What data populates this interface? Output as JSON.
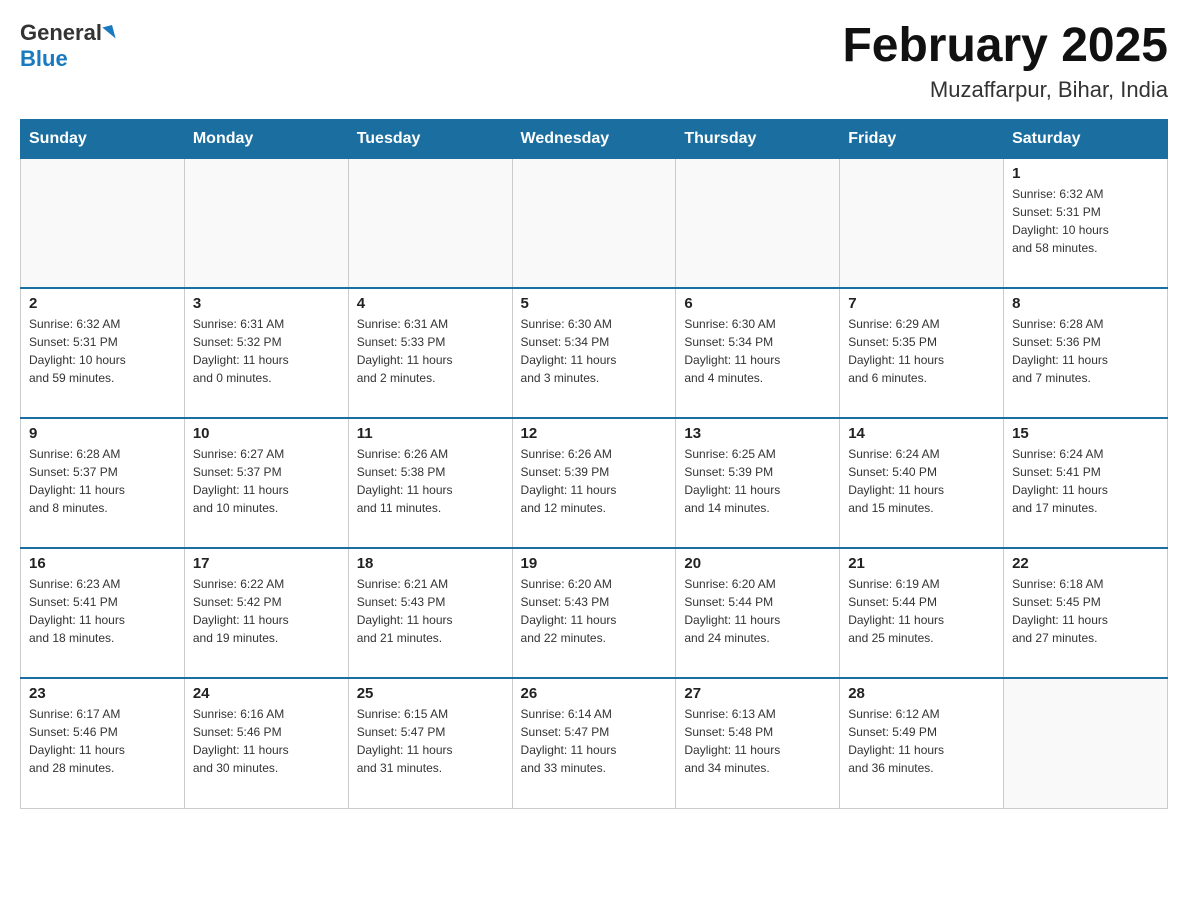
{
  "logo": {
    "general": "General",
    "blue": "Blue"
  },
  "title": "February 2025",
  "subtitle": "Muzaffarpur, Bihar, India",
  "headers": [
    "Sunday",
    "Monday",
    "Tuesday",
    "Wednesday",
    "Thursday",
    "Friday",
    "Saturday"
  ],
  "weeks": [
    [
      {
        "day": "",
        "info": ""
      },
      {
        "day": "",
        "info": ""
      },
      {
        "day": "",
        "info": ""
      },
      {
        "day": "",
        "info": ""
      },
      {
        "day": "",
        "info": ""
      },
      {
        "day": "",
        "info": ""
      },
      {
        "day": "1",
        "info": "Sunrise: 6:32 AM\nSunset: 5:31 PM\nDaylight: 10 hours\nand 58 minutes."
      }
    ],
    [
      {
        "day": "2",
        "info": "Sunrise: 6:32 AM\nSunset: 5:31 PM\nDaylight: 10 hours\nand 59 minutes."
      },
      {
        "day": "3",
        "info": "Sunrise: 6:31 AM\nSunset: 5:32 PM\nDaylight: 11 hours\nand 0 minutes."
      },
      {
        "day": "4",
        "info": "Sunrise: 6:31 AM\nSunset: 5:33 PM\nDaylight: 11 hours\nand 2 minutes."
      },
      {
        "day": "5",
        "info": "Sunrise: 6:30 AM\nSunset: 5:34 PM\nDaylight: 11 hours\nand 3 minutes."
      },
      {
        "day": "6",
        "info": "Sunrise: 6:30 AM\nSunset: 5:34 PM\nDaylight: 11 hours\nand 4 minutes."
      },
      {
        "day": "7",
        "info": "Sunrise: 6:29 AM\nSunset: 5:35 PM\nDaylight: 11 hours\nand 6 minutes."
      },
      {
        "day": "8",
        "info": "Sunrise: 6:28 AM\nSunset: 5:36 PM\nDaylight: 11 hours\nand 7 minutes."
      }
    ],
    [
      {
        "day": "9",
        "info": "Sunrise: 6:28 AM\nSunset: 5:37 PM\nDaylight: 11 hours\nand 8 minutes."
      },
      {
        "day": "10",
        "info": "Sunrise: 6:27 AM\nSunset: 5:37 PM\nDaylight: 11 hours\nand 10 minutes."
      },
      {
        "day": "11",
        "info": "Sunrise: 6:26 AM\nSunset: 5:38 PM\nDaylight: 11 hours\nand 11 minutes."
      },
      {
        "day": "12",
        "info": "Sunrise: 6:26 AM\nSunset: 5:39 PM\nDaylight: 11 hours\nand 12 minutes."
      },
      {
        "day": "13",
        "info": "Sunrise: 6:25 AM\nSunset: 5:39 PM\nDaylight: 11 hours\nand 14 minutes."
      },
      {
        "day": "14",
        "info": "Sunrise: 6:24 AM\nSunset: 5:40 PM\nDaylight: 11 hours\nand 15 minutes."
      },
      {
        "day": "15",
        "info": "Sunrise: 6:24 AM\nSunset: 5:41 PM\nDaylight: 11 hours\nand 17 minutes."
      }
    ],
    [
      {
        "day": "16",
        "info": "Sunrise: 6:23 AM\nSunset: 5:41 PM\nDaylight: 11 hours\nand 18 minutes."
      },
      {
        "day": "17",
        "info": "Sunrise: 6:22 AM\nSunset: 5:42 PM\nDaylight: 11 hours\nand 19 minutes."
      },
      {
        "day": "18",
        "info": "Sunrise: 6:21 AM\nSunset: 5:43 PM\nDaylight: 11 hours\nand 21 minutes."
      },
      {
        "day": "19",
        "info": "Sunrise: 6:20 AM\nSunset: 5:43 PM\nDaylight: 11 hours\nand 22 minutes."
      },
      {
        "day": "20",
        "info": "Sunrise: 6:20 AM\nSunset: 5:44 PM\nDaylight: 11 hours\nand 24 minutes."
      },
      {
        "day": "21",
        "info": "Sunrise: 6:19 AM\nSunset: 5:44 PM\nDaylight: 11 hours\nand 25 minutes."
      },
      {
        "day": "22",
        "info": "Sunrise: 6:18 AM\nSunset: 5:45 PM\nDaylight: 11 hours\nand 27 minutes."
      }
    ],
    [
      {
        "day": "23",
        "info": "Sunrise: 6:17 AM\nSunset: 5:46 PM\nDaylight: 11 hours\nand 28 minutes."
      },
      {
        "day": "24",
        "info": "Sunrise: 6:16 AM\nSunset: 5:46 PM\nDaylight: 11 hours\nand 30 minutes."
      },
      {
        "day": "25",
        "info": "Sunrise: 6:15 AM\nSunset: 5:47 PM\nDaylight: 11 hours\nand 31 minutes."
      },
      {
        "day": "26",
        "info": "Sunrise: 6:14 AM\nSunset: 5:47 PM\nDaylight: 11 hours\nand 33 minutes."
      },
      {
        "day": "27",
        "info": "Sunrise: 6:13 AM\nSunset: 5:48 PM\nDaylight: 11 hours\nand 34 minutes."
      },
      {
        "day": "28",
        "info": "Sunrise: 6:12 AM\nSunset: 5:49 PM\nDaylight: 11 hours\nand 36 minutes."
      },
      {
        "day": "",
        "info": ""
      }
    ]
  ]
}
